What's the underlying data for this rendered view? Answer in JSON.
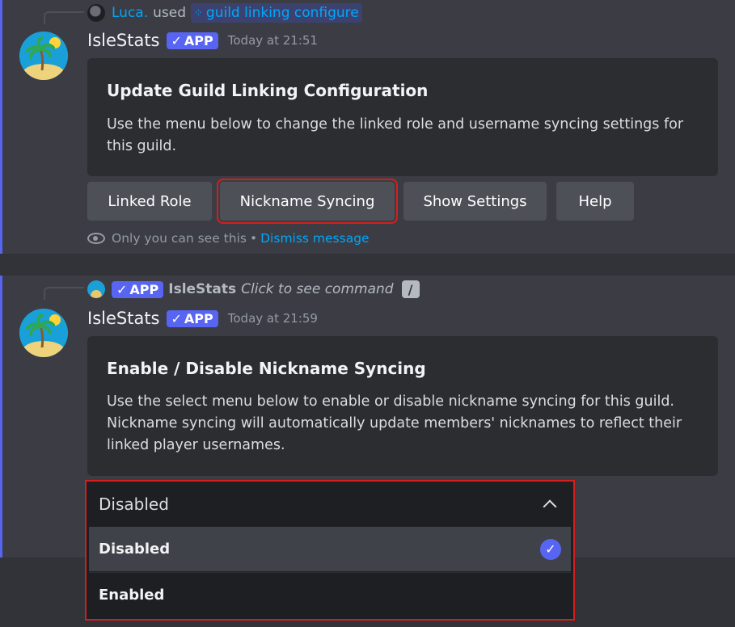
{
  "message1": {
    "reply": {
      "user": "Luca.",
      "used": "used",
      "command_icon": "slash-command-icon",
      "command": "guild linking configure"
    },
    "author": "IsleStats",
    "badge": "APP",
    "timestamp": "Today at 21:51",
    "embed": {
      "title": "Update Guild Linking Configuration",
      "description": "Use the menu below to change the linked role and username syncing settings for this guild."
    },
    "buttons": [
      "Linked Role",
      "Nickname Syncing",
      "Show Settings",
      "Help"
    ],
    "ephemeral": {
      "text": "Only you can see this",
      "separator": "•",
      "dismiss": "Dismiss message"
    }
  },
  "message2": {
    "reply": {
      "badge": "APP",
      "author": "IsleStats",
      "hint": "Click to see command",
      "icon": "slash-icon"
    },
    "author": "IsleStats",
    "badge": "APP",
    "timestamp": "Today at 21:59",
    "embed": {
      "title": "Enable / Disable Nickname Syncing",
      "description": "Use the select menu below to enable or disable nickname syncing for this guild. Nickname syncing will automatically update members' nicknames to reflect their linked player usernames."
    },
    "select": {
      "value": "Disabled",
      "options": [
        {
          "label": "Disabled",
          "selected": true
        },
        {
          "label": "Enabled",
          "selected": false
        }
      ]
    }
  },
  "colors": {
    "accent": "#5865f2",
    "link": "#00a8fc",
    "highlight": "#d61e1e",
    "background": "#313338"
  }
}
